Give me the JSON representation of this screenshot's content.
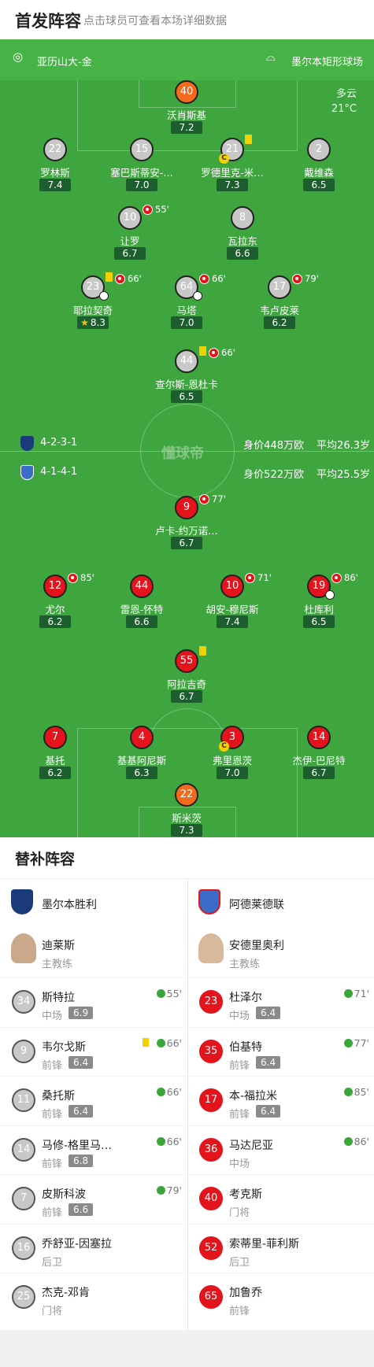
{
  "header": {
    "title": "首发阵容",
    "subtitle": "点击球员可查看本场详细数据"
  },
  "venue": {
    "referee": "亚历山大-金",
    "stadium": "墨尔本矩形球场"
  },
  "weather": {
    "condition": "多云",
    "temp": "21°C"
  },
  "watermark": "懂球帝",
  "home_info": {
    "formation": "4-2-3-1",
    "value": "身价448万欧",
    "age": "平均26.3岁",
    "color": "#1a3a7a"
  },
  "away_info": {
    "formation": "4-1-4-1",
    "value": "身价522万欧",
    "age": "平均25.5岁",
    "color": "#3b6cc7"
  },
  "home_players": [
    {
      "num": "40",
      "name": "沃肖斯基",
      "rating": "7.2",
      "gk": true
    },
    {
      "num": "22",
      "name": "罗林斯",
      "rating": "7.4"
    },
    {
      "num": "15",
      "name": "塞巴斯蒂安-…",
      "rating": "7.0"
    },
    {
      "num": "21",
      "name": "罗德里克-米…",
      "rating": "7.3"
    },
    {
      "num": "2",
      "name": "戴维森",
      "rating": "6.5"
    },
    {
      "num": "10",
      "name": "让罗",
      "rating": "6.7",
      "sub_min": "55'"
    },
    {
      "num": "8",
      "name": "瓦拉东",
      "rating": "6.6"
    },
    {
      "num": "23",
      "name": "耶拉契奇",
      "rating": "8.3",
      "sub_min": "66'",
      "best": true
    },
    {
      "num": "64",
      "name": "马塔",
      "rating": "7.0",
      "sub_min": "66'"
    },
    {
      "num": "17",
      "name": "韦卢皮莱",
      "rating": "6.2",
      "sub_min": "79'"
    },
    {
      "num": "44",
      "name": "查尔斯-恩杜卡",
      "rating": "6.5",
      "sub_min": "66'"
    }
  ],
  "away_players": [
    {
      "num": "9",
      "name": "卢卡-约万诺…",
      "rating": "6.7",
      "sub_min": "77'"
    },
    {
      "num": "12",
      "name": "尤尔",
      "rating": "6.2",
      "sub_min": "85'"
    },
    {
      "num": "44",
      "name": "雷恩-怀特",
      "rating": "6.6"
    },
    {
      "num": "10",
      "name": "胡安-穆尼斯",
      "rating": "7.4",
      "sub_min": "71'"
    },
    {
      "num": "19",
      "name": "杜库利",
      "rating": "6.5",
      "sub_min": "86'"
    },
    {
      "num": "55",
      "name": "阿拉吉奇",
      "rating": "6.7"
    },
    {
      "num": "7",
      "name": "基托",
      "rating": "6.2"
    },
    {
      "num": "4",
      "name": "基基阿尼斯",
      "rating": "6.3"
    },
    {
      "num": "3",
      "name": "弗里恩茨",
      "rating": "7.0"
    },
    {
      "num": "14",
      "name": "杰伊-巴尼特",
      "rating": "6.7"
    },
    {
      "num": "22",
      "name": "斯米茨",
      "rating": "7.3",
      "gk": true
    }
  ],
  "subs": {
    "title": "替补阵容",
    "home": {
      "team": "墨尔本胜利",
      "coach": "迪莱斯",
      "coach_role": "主教练",
      "logo_color": "#1a3a7a",
      "players": [
        {
          "num": "34",
          "name": "斯特拉",
          "pos": "中场",
          "rating": "6.9",
          "in": "55'"
        },
        {
          "num": "9",
          "name": "韦尔戈斯",
          "pos": "前锋",
          "rating": "6.4",
          "in": "66'",
          "yellow": true
        },
        {
          "num": "11",
          "name": "桑托斯",
          "pos": "前锋",
          "rating": "6.4",
          "in": "66'"
        },
        {
          "num": "14",
          "name": "马修-格里马…",
          "pos": "前锋",
          "rating": "6.8",
          "in": "66'"
        },
        {
          "num": "7",
          "name": "皮斯科波",
          "pos": "前锋",
          "rating": "6.6",
          "in": "79'"
        },
        {
          "num": "16",
          "name": "乔舒亚-因塞拉",
          "pos": "后卫"
        },
        {
          "num": "25",
          "name": "杰克-邓肯",
          "pos": "门将"
        }
      ]
    },
    "away": {
      "team": "阿德莱德联",
      "coach": "安德里奥利",
      "coach_role": "主教练",
      "logo_color": "#3b6cc7",
      "players": [
        {
          "num": "23",
          "name": "杜泽尔",
          "pos": "中场",
          "rating": "6.4",
          "in": "71'"
        },
        {
          "num": "35",
          "name": "伯基特",
          "pos": "前锋",
          "rating": "6.4",
          "in": "77'"
        },
        {
          "num": "17",
          "name": "本-福拉米",
          "pos": "前锋",
          "rating": "6.4",
          "in": "85'"
        },
        {
          "num": "36",
          "name": "马达尼亚",
          "pos": "中场",
          "in": "86'"
        },
        {
          "num": "40",
          "name": "考克斯",
          "pos": "门将"
        },
        {
          "num": "52",
          "name": "索蒂里-菲利斯",
          "pos": "后卫"
        },
        {
          "num": "65",
          "name": "加鲁乔",
          "pos": "前锋"
        }
      ]
    }
  }
}
